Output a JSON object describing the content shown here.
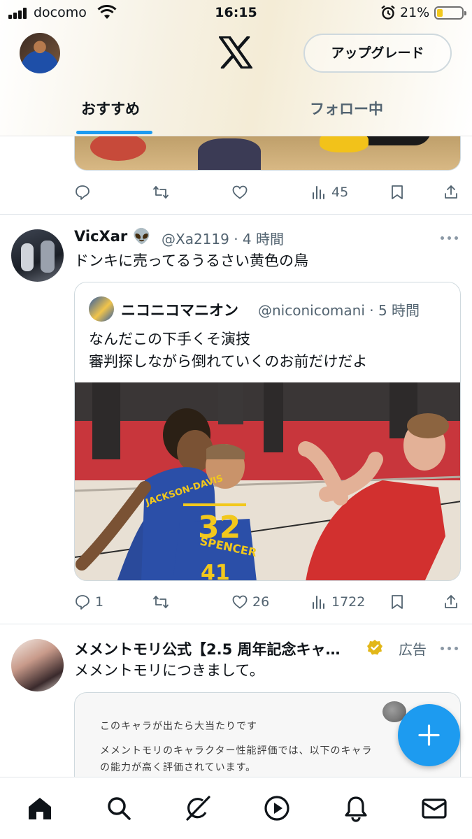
{
  "status_bar": {
    "carrier": "docomo",
    "time": "16:15",
    "battery": "21%"
  },
  "header": {
    "upgrade_label": "アップグレード"
  },
  "tabs": [
    {
      "label": "おすすめ",
      "active": true
    },
    {
      "label": "フォロー中",
      "active": false
    }
  ],
  "feed": {
    "prev_post": {
      "views": "45"
    },
    "post1": {
      "name": "VicXar",
      "name_emoji": "👽",
      "handle_time": "@Xa2119 · 4 時間",
      "text": "ドンキに売ってるうるさい黄色の鳥",
      "quote": {
        "name": "ニコニコマニオン",
        "handle_time": "@niconicomani · 5 時間",
        "text_line1": "なんだこの下手くそ演技",
        "text_line2": "審判探しながら倒れていくのお前だけだよ",
        "jersey1": "32",
        "jersey1_name": "JACKSON-DAVIS",
        "jersey2": "41",
        "jersey2_name": "SPENCER"
      },
      "replies": "1",
      "likes": "26",
      "views": "1722"
    },
    "ad_post": {
      "name": "メメントモリ公式【2.5 周年記念キャ…",
      "ad_label": "広告",
      "text": "メメントモリにつきまして。",
      "card_line1": "このキャラが出たら大当たりです",
      "card_line2": "メメントモリのキャラクター性能評価では、以下のキャラ",
      "card_line3": "の能力が高く評価されています。"
    }
  },
  "colors": {
    "accent": "#1d9bf0",
    "verified_gold": "#e2b719",
    "muted": "#536471"
  },
  "nav_icons": [
    "home-icon",
    "search-icon",
    "grok-icon",
    "video-icon",
    "notifications-icon",
    "messages-icon"
  ]
}
